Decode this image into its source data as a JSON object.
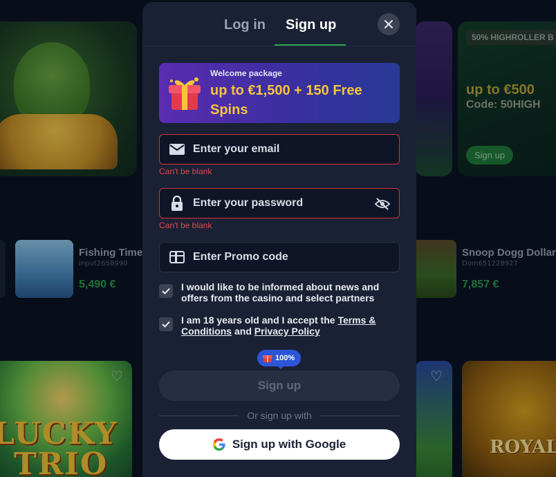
{
  "background": {
    "highroller": {
      "badge": "50% HIGHROLLER B",
      "title": "up to €500",
      "code": "Code: 50HIGH",
      "button": "Sign up"
    },
    "winners": [
      {
        "game": "Fishing Time",
        "user": "Input2658990",
        "amount": "5,490 €"
      },
      {
        "game": "Snoop Dogg Dollar",
        "user": "Dom651228927",
        "amount": "7,857 €"
      }
    ],
    "tiles": {
      "lucky_line1": "LUCKY",
      "lucky_line2": "TRIO",
      "royal": "ROYAL BEE"
    }
  },
  "modal": {
    "tabs": {
      "login": "Log in",
      "signup": "Sign up"
    },
    "active_tab": "signup",
    "promo": {
      "small": "Welcome package",
      "big": "up to €1,500 + 150 Free Spins"
    },
    "email": {
      "placeholder": "Enter your email",
      "value": "",
      "error": "Can't be blank"
    },
    "password": {
      "placeholder": "Enter your password",
      "value": "",
      "error": "Can't be blank"
    },
    "promo_code": {
      "placeholder": "Enter Promo code",
      "value": ""
    },
    "checkboxes": {
      "news": {
        "checked": true,
        "text": "I would like to be informed about news and offers from the casino and select partners"
      },
      "age": {
        "checked": true,
        "pre": "I am 18 years old and I accept the ",
        "terms": "Terms & Conditions",
        "and": " and ",
        "privacy": "Privacy Policy"
      }
    },
    "bonus_badge": "100%",
    "signup_button": "Sign up",
    "divider": "Or sign up with",
    "google_button": "Sign up with Google"
  },
  "colors": {
    "accent_green": "#2aa84a",
    "error_red": "#d0353b",
    "promo_gold": "#f6c53a",
    "badge_blue": "#2c55d8"
  },
  "icons": [
    "close-icon",
    "gift-icon",
    "mail-icon",
    "lock-icon",
    "eye-off-icon",
    "ticket-icon",
    "check-icon",
    "google-icon",
    "heart-icon"
  ]
}
